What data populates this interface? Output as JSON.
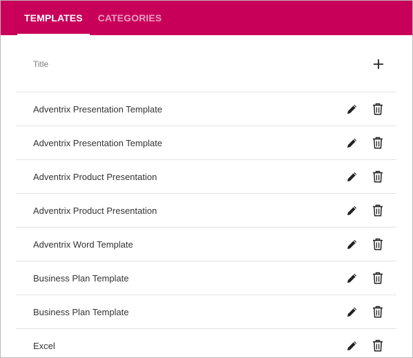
{
  "tabs": [
    {
      "label": "TEMPLATES",
      "active": true
    },
    {
      "label": "CATEGORIES",
      "active": false
    }
  ],
  "colors": {
    "accent": "#c9005a",
    "text": "#333333",
    "muted": "#7a7a7a",
    "divider": "#e2e2e2"
  },
  "list": {
    "header": "Title",
    "add_icon": "plus-icon",
    "rows": [
      {
        "title": "Adventrix Presentation Template"
      },
      {
        "title": "Adventrix Presentation Template"
      },
      {
        "title": "Adventrix Product Presentation"
      },
      {
        "title": "Adventrix Product Presentation"
      },
      {
        "title": "Adventrix Word Template"
      },
      {
        "title": "Business Plan Template"
      },
      {
        "title": "Business Plan Template"
      },
      {
        "title": "Excel"
      }
    ],
    "row_icons": [
      "pencil-icon",
      "trash-icon"
    ]
  }
}
